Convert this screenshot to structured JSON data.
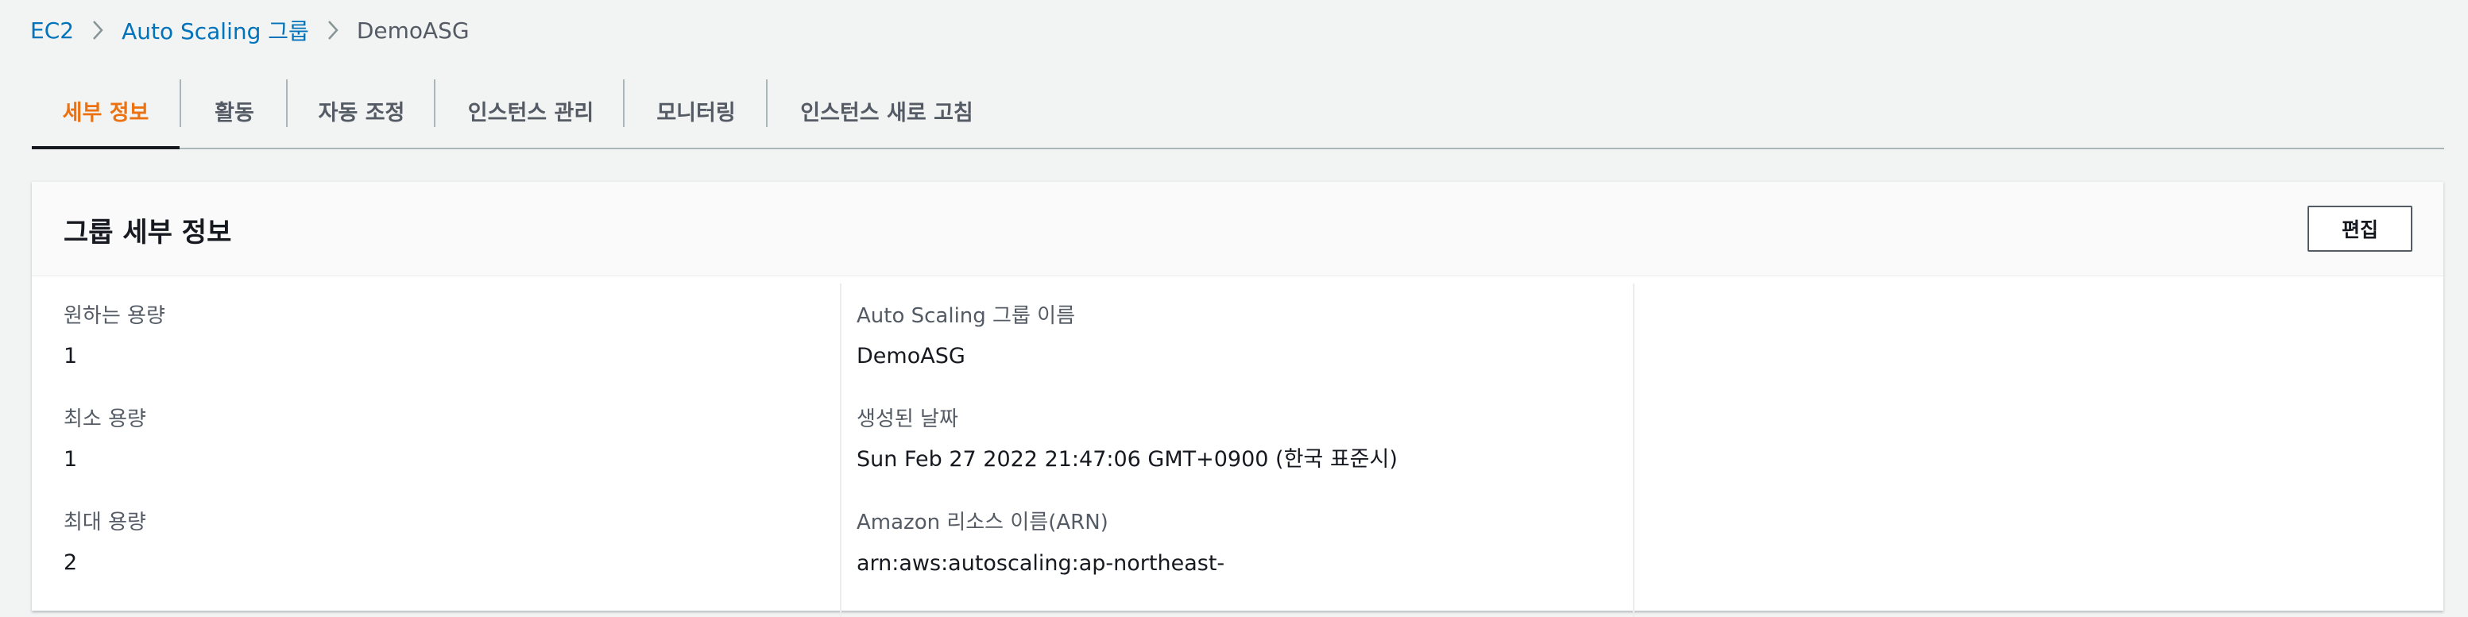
{
  "breadcrumb": {
    "items": [
      "EC2",
      "Auto Scaling 그룹"
    ],
    "current": "DemoASG",
    "separator_icon": "chevron-right-icon"
  },
  "tabs": [
    {
      "label": "세부 정보",
      "active": true
    },
    {
      "label": "활동",
      "active": false
    },
    {
      "label": "자동 조정",
      "active": false
    },
    {
      "label": "인스턴스 관리",
      "active": false
    },
    {
      "label": "모니터링",
      "active": false
    },
    {
      "label": "인스턴스 새로 고침",
      "active": false
    }
  ],
  "panel": {
    "title": "그룹 세부 정보",
    "edit_label": "편집",
    "left_fields": [
      {
        "label": "원하는 용량",
        "value": "1"
      },
      {
        "label": "최소 용량",
        "value": "1"
      },
      {
        "label": "최대 용량",
        "value": "2"
      }
    ],
    "middle_fields": [
      {
        "label": "Auto Scaling 그룹 이름",
        "value": "DemoASG"
      },
      {
        "label": "생성된 날짜",
        "value": "Sun Feb 27 2022 21:47:06 GMT+0900 (한국 표준시)"
      },
      {
        "label": "Amazon 리소스 이름(ARN)",
        "value": "arn:aws:autoscaling:ap-northeast-"
      }
    ]
  },
  "colors": {
    "link": "#0073bb",
    "active_tab": "#ec7211",
    "text": "#16191f",
    "muted": "#545b64",
    "background": "#f2f3f3"
  }
}
